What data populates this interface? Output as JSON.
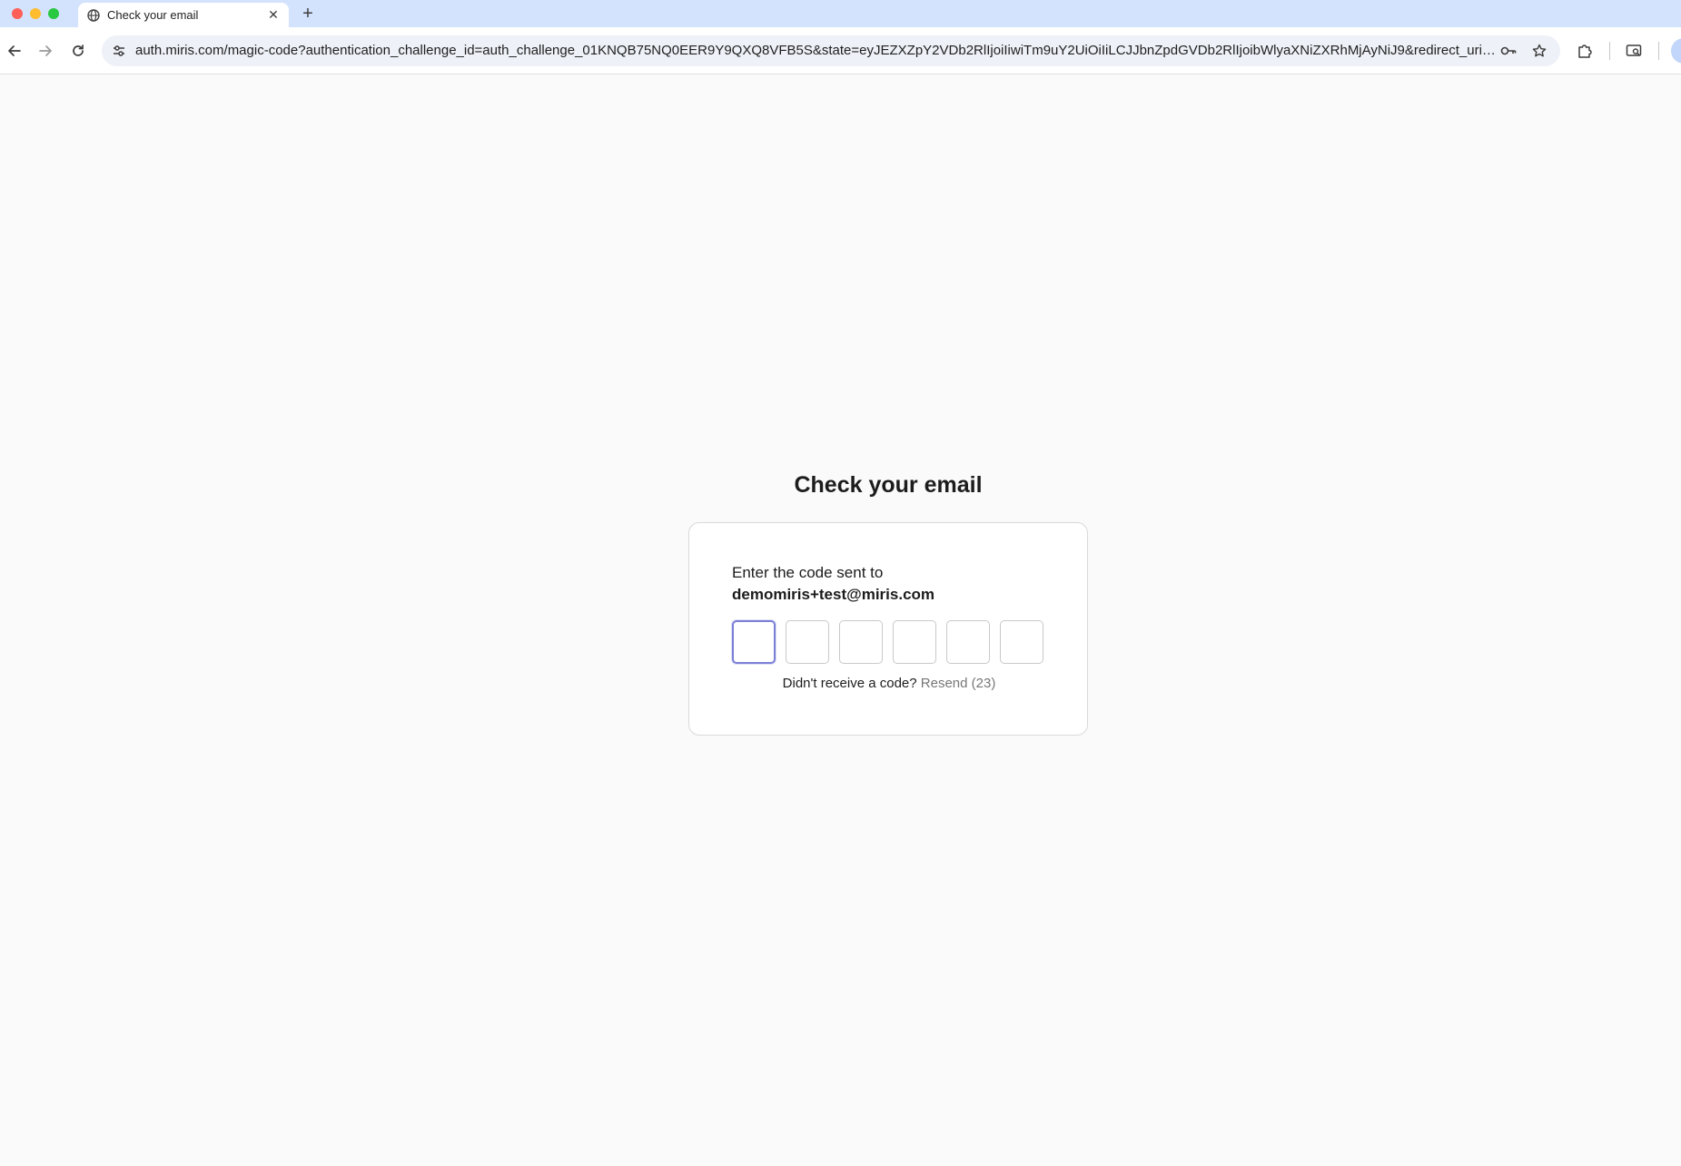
{
  "browser": {
    "tab_title": "Check your email",
    "tab_close": "✕",
    "new_tab": "+",
    "url": "auth.miris.com/magic-code?authentication_challenge_id=auth_challenge_01KNQB75NQ0EER9Y9QXQ8VFB5S&state=eyJEZXZpY2VDb2RlIjoiIiwiTm9uY2UiOiIiLCJJbnZpdGVDb2RlIjoibWlyaXNiZXRhMjAyNiJ9&redirect_uri=http..."
  },
  "main": {
    "title": "Check your email",
    "instruction": "Enter the code sent to",
    "email": "demomiris+test@miris.com",
    "code_digits": [
      "",
      "",
      "",
      "",
      "",
      ""
    ],
    "resend_prompt": "Didn't receive a code?",
    "resend_label": "Resend (23)"
  },
  "colors": {
    "tabstrip": "#d3e3fd",
    "focus_ring": "#7b80d6",
    "page_bg": "#fafafa"
  },
  "icons": {
    "back": "arrow-left-icon",
    "forward": "arrow-right-icon",
    "reload": "reload-icon",
    "site_info": "tune-icon",
    "password": "key-icon",
    "bookmark": "star-icon",
    "extensions": "puzzle-icon",
    "media": "cast-search-icon",
    "favicon": "globe-icon"
  }
}
